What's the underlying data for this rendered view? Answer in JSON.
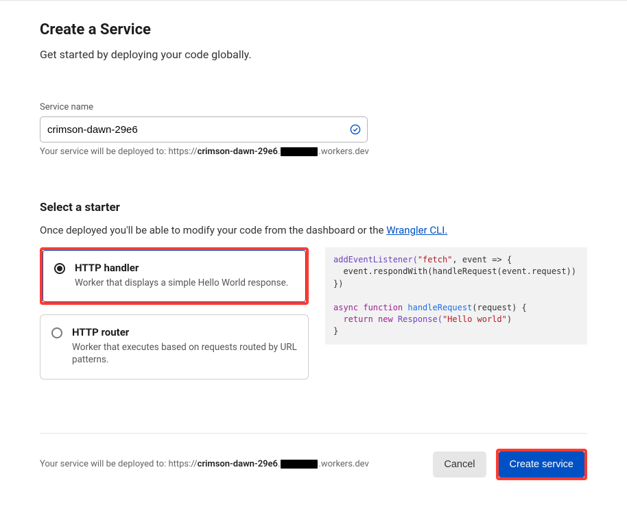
{
  "header": {
    "title": "Create a Service",
    "subtitle": "Get started by deploying your code globally."
  },
  "service_name": {
    "label": "Service name",
    "value": "crimson-dawn-29e6",
    "hint_prefix": "Your service will be deployed to: https://",
    "hint_bold": "crimson-dawn-29e6",
    "hint_suffix": ".workers.dev"
  },
  "starter": {
    "heading": "Select a starter",
    "description_text": "Once deployed you'll be able to modify your code from the dashboard or the ",
    "link_text": "Wrangler CLI.",
    "options": [
      {
        "title": "HTTP handler",
        "subtitle": "Worker that displays a simple Hello World response.",
        "selected": true
      },
      {
        "title": "HTTP router",
        "subtitle": "Worker that executes based on requests routed by URL patterns.",
        "selected": false
      }
    ]
  },
  "code": {
    "line1a": "addEventListener(",
    "line1b": "\"fetch\"",
    "line1c": ", event => {",
    "line2": "  event.respondWith(handleRequest(event.request))",
    "line3": "})",
    "blank": "",
    "line4_async": "async",
    "line4_function": " function ",
    "line4_name": "handleRequest",
    "line4_rest": "(request) {",
    "line5_return": "  return",
    "line5_new": " new ",
    "line5_resp": "Response(",
    "line5_str": "\"Hello world\"",
    "line5_end": ")",
    "line6": "}"
  },
  "footer": {
    "deploy_prefix": "Your service will be deployed to: https://",
    "deploy_bold": "crimson-dawn-29e6",
    "deploy_suffix": ".workers.dev",
    "cancel": "Cancel",
    "create": "Create service"
  }
}
